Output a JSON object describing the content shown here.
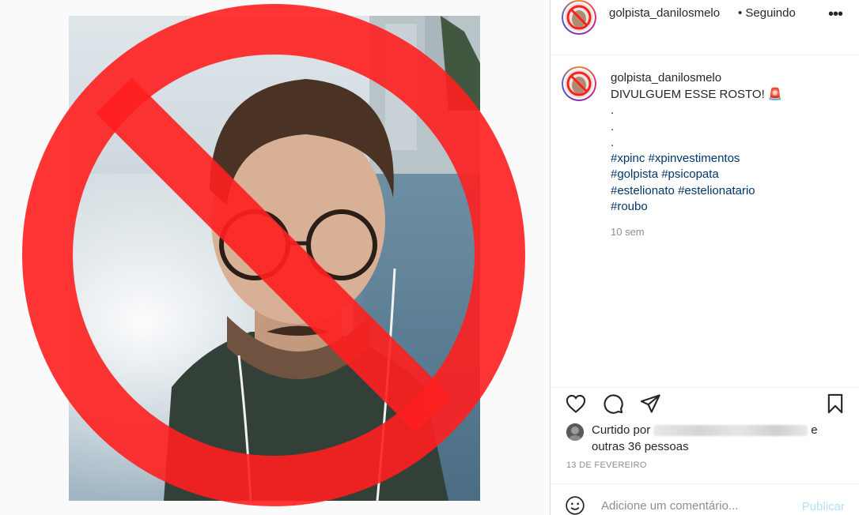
{
  "post": {
    "username": "golpista_danilosmelo",
    "header_username": "golpista_danilosmelo",
    "follow_state": "• Seguindo",
    "more_icon": "more-horizontal-icon"
  },
  "caption": {
    "username": "golpista_danilosmelo",
    "lines": [
      {
        "text": "DIVULGUEM ESSE ROSTO! 🚨",
        "type": "text"
      },
      {
        "text": ".",
        "type": "text"
      },
      {
        "text": ".",
        "type": "text"
      },
      {
        "text": ".",
        "type": "text"
      },
      {
        "text": "#xpinc #xpinvestimentos",
        "type": "hashtag"
      },
      {
        "text": "#golpista #psicopata",
        "type": "hashtag"
      },
      {
        "text": "#estelionato #estelionatario",
        "type": "hashtag"
      },
      {
        "text": "#roubo",
        "type": "hashtag"
      }
    ],
    "time_ago": "10 sem"
  },
  "actions": {
    "like_icon": "heart-icon",
    "comment_icon": "comment-bubble-icon",
    "share_icon": "paper-plane-icon",
    "save_icon": "bookmark-icon"
  },
  "likes": {
    "prefix": "Curtido por",
    "suffix_line1": "e",
    "suffix_line2": "outras 36 pessoas"
  },
  "post_date": "13 DE FEVEREIRO",
  "comment_box": {
    "placeholder": "Adicione um comentário...",
    "publish_label": "Publicar",
    "emoji_icon": "smiley-face-icon"
  },
  "colors": {
    "ban_red": "#ff1f1f",
    "hashtag_blue": "#00376b",
    "muted_text": "#8e8e8e",
    "publish_disabled": "#b2dffc"
  }
}
